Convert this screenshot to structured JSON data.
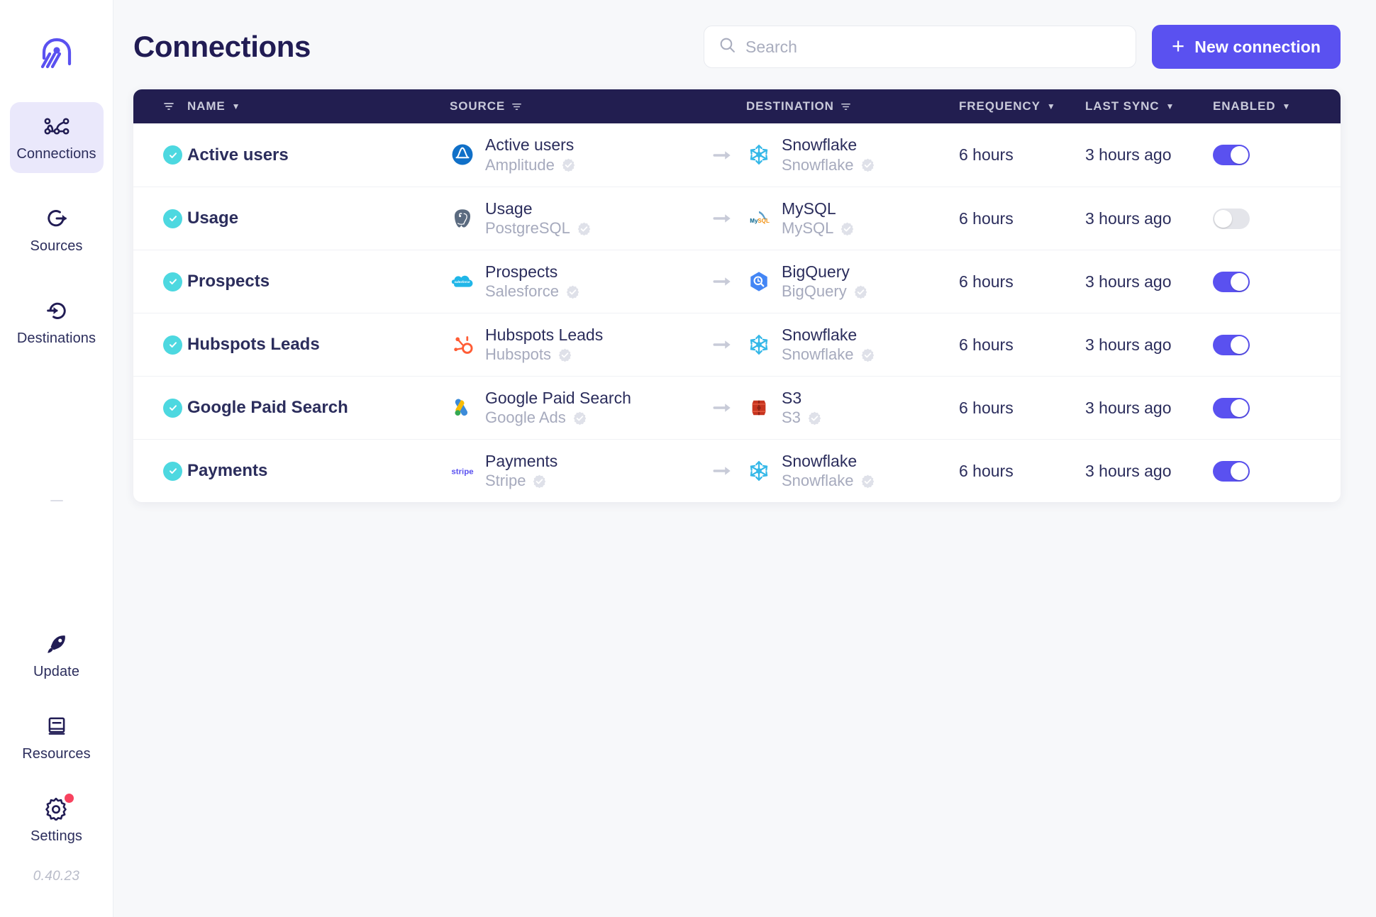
{
  "sidebar": {
    "logo_name": "logo-mark",
    "version": "0.40.23",
    "top_items": [
      {
        "id": "connections",
        "label": "Connections",
        "icon": "connections-icon",
        "active": true
      },
      {
        "id": "sources",
        "label": "Sources",
        "icon": "sources-icon",
        "active": false
      },
      {
        "id": "destinations",
        "label": "Destinations",
        "icon": "destinations-icon",
        "active": false
      }
    ],
    "bottom_items": [
      {
        "id": "update",
        "label": "Update",
        "icon": "rocket-icon",
        "badge": false
      },
      {
        "id": "resources",
        "label": "Resources",
        "icon": "book-icon",
        "badge": false
      },
      {
        "id": "settings",
        "label": "Settings",
        "icon": "gear-icon",
        "badge": true
      }
    ]
  },
  "header": {
    "title": "Connections",
    "search_placeholder": "Search",
    "search_value": "",
    "new_connection_label": "New connection",
    "plus": "+"
  },
  "table": {
    "columns": {
      "filter": "filter-icon",
      "name": "NAME",
      "source": "SOURCE",
      "destination": "DESTINATION",
      "frequency": "FREQUENCY",
      "last_sync": "LAST SYNC",
      "enabled": "ENABLED"
    },
    "rows": [
      {
        "status": "ok",
        "name": "Active users",
        "source": {
          "title": "Active users",
          "subtitle": "Amplitude",
          "icon": "amplitude-icon",
          "verified": true
        },
        "destination": {
          "title": "Snowflake",
          "subtitle": "Snowflake",
          "icon": "snowflake-icon",
          "verified": true
        },
        "frequency": "6 hours",
        "last_sync": "3 hours ago",
        "enabled": true
      },
      {
        "status": "ok",
        "name": "Usage",
        "source": {
          "title": "Usage",
          "subtitle": "PostgreSQL",
          "icon": "postgresql-icon",
          "verified": true
        },
        "destination": {
          "title": "MySQL",
          "subtitle": "MySQL",
          "icon": "mysql-icon",
          "verified": true
        },
        "frequency": "6 hours",
        "last_sync": "3 hours ago",
        "enabled": false
      },
      {
        "status": "ok",
        "name": "Prospects",
        "source": {
          "title": "Prospects",
          "subtitle": "Salesforce",
          "icon": "salesforce-icon",
          "verified": true
        },
        "destination": {
          "title": "BigQuery",
          "subtitle": "BigQuery",
          "icon": "bigquery-icon",
          "verified": true
        },
        "frequency": "6 hours",
        "last_sync": "3 hours ago",
        "enabled": true
      },
      {
        "status": "ok",
        "name": "Hubspots Leads",
        "source": {
          "title": "Hubspots Leads",
          "subtitle": "Hubspots",
          "icon": "hubspot-icon",
          "verified": true
        },
        "destination": {
          "title": "Snowflake",
          "subtitle": "Snowflake",
          "icon": "snowflake-icon",
          "verified": true
        },
        "frequency": "6 hours",
        "last_sync": "3 hours ago",
        "enabled": true
      },
      {
        "status": "ok",
        "name": "Google Paid Search",
        "source": {
          "title": "Google Paid Search",
          "subtitle": "Google Ads",
          "icon": "google-ads-icon",
          "verified": true
        },
        "destination": {
          "title": "S3",
          "subtitle": "S3",
          "icon": "s3-icon",
          "verified": true
        },
        "frequency": "6 hours",
        "last_sync": "3 hours ago",
        "enabled": true
      },
      {
        "status": "ok",
        "name": "Payments",
        "source": {
          "title": "Payments",
          "subtitle": "Stripe",
          "icon": "stripe-icon",
          "verified": true
        },
        "destination": {
          "title": "Snowflake",
          "subtitle": "Snowflake",
          "icon": "snowflake-icon",
          "verified": true
        },
        "frequency": "6 hours",
        "last_sync": "3 hours ago",
        "enabled": true
      }
    ]
  },
  "colors": {
    "accent": "#5a51f0",
    "header_bar": "#221e50",
    "status_ok": "#4dd8e0",
    "badge": "#f8425f",
    "text": "#2b2d5c",
    "muted": "#a6aabd"
  }
}
